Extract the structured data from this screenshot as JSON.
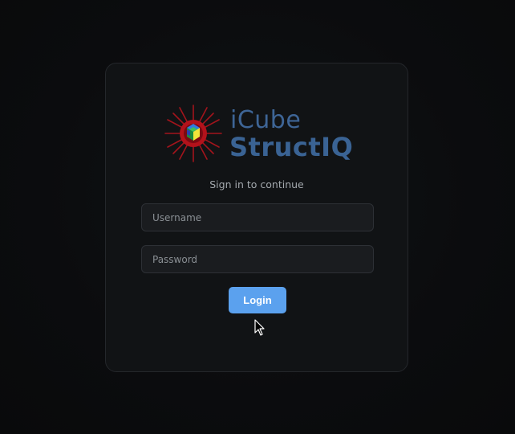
{
  "logo": {
    "line1": "iCube",
    "line2": "StructIQ",
    "icon": "sun-cube-logo-icon"
  },
  "login": {
    "subtitle": "Sign in to continue",
    "username_placeholder": "Username",
    "username_value": "",
    "password_placeholder": "Password",
    "password_value": "",
    "button_label": "Login"
  },
  "colors": {
    "background": "#0b0c0e",
    "card": "#111315",
    "accent": "#5ba1ee",
    "logo_text": "#3e6596",
    "logo_red": "#b3121b"
  }
}
